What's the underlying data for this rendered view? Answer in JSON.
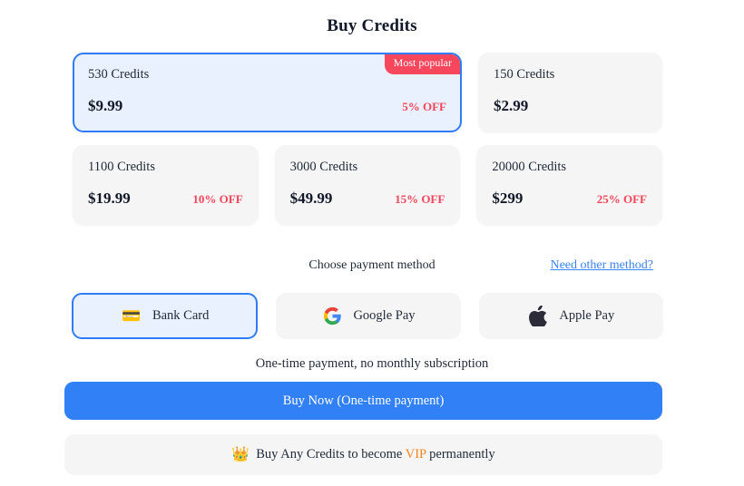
{
  "header": {
    "title": "Buy Credits"
  },
  "packages": [
    {
      "credits": "530 Credits",
      "price": "$9.99",
      "discount": "5% OFF",
      "badge": "Most popular",
      "selected": true
    },
    {
      "credits": "150 Credits",
      "price": "$2.99",
      "discount": "",
      "badge": "",
      "selected": false
    },
    {
      "credits": "1100 Credits",
      "price": "$19.99",
      "discount": "10% OFF",
      "badge": "",
      "selected": false
    },
    {
      "credits": "3000 Credits",
      "price": "$49.99",
      "discount": "15% OFF",
      "badge": "",
      "selected": false
    },
    {
      "credits": "20000 Credits",
      "price": "$299",
      "discount": "25% OFF",
      "badge": "",
      "selected": false
    }
  ],
  "payment": {
    "heading": "Choose payment method",
    "other_method_link": "Need other method?",
    "methods": [
      {
        "label": "Bank Card",
        "icon": "credit-card-icon",
        "glyph": "💳",
        "selected": true
      },
      {
        "label": "Google Pay",
        "icon": "google-logo-icon",
        "glyph": "",
        "selected": false
      },
      {
        "label": "Apple Pay",
        "icon": "apple-logo-icon",
        "glyph": "",
        "selected": false
      }
    ]
  },
  "footer": {
    "note": "One-time payment, no monthly subscription",
    "buy_button": "Buy Now (One-time payment)",
    "vip_crown_icon": "crown-icon",
    "vip_crown_glyph": "👑",
    "vip_text_before": "Buy Any Credits to become ",
    "vip_word": "VIP",
    "vip_text_after": " permanently"
  },
  "colors": {
    "accent_blue": "#3180f6",
    "selected_border": "#2f7cf6",
    "selected_fill": "#eaf1fe",
    "badge_red": "#f7475c",
    "discount_red": "#f4455c",
    "card_grey": "#f5f5f5",
    "vip_orange": "#f2861e",
    "link_blue": "#3b82f6"
  }
}
